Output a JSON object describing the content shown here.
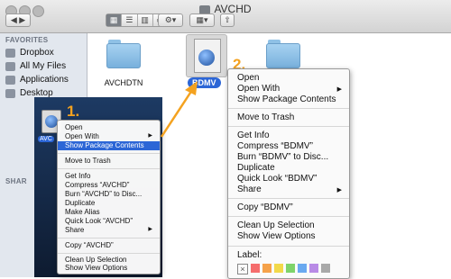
{
  "window": {
    "title": "AVCHD",
    "toolbar": {
      "gear_label": "⚙▾",
      "arrange_label": "▦▾",
      "share_label": "⇧"
    }
  },
  "sidebar": {
    "section": "FAVORITES",
    "items": [
      "Dropbox",
      "All My Files",
      "Applications",
      "Desktop"
    ],
    "shared_header": "SHAR"
  },
  "files": [
    {
      "name": "AVCHDTN"
    },
    {
      "name": "BDMV"
    }
  ],
  "desktop_file_label": "AVC",
  "steps": {
    "one": "1.",
    "two": "2."
  },
  "menu_small": {
    "items": [
      "Open",
      "Open With",
      "Show Package Contents",
      "Move to Trash",
      "Get Info",
      "Compress “AVCHD”",
      "Burn “AVCHD” to Disc...",
      "Duplicate",
      "Make Alias",
      "Quick Look “AVCHD”",
      "Share",
      "Copy “AVCHD”",
      "Clean Up Selection",
      "Show View Options"
    ]
  },
  "menu_large": {
    "items": [
      "Open",
      "Open With",
      "Show Package Contents",
      "Move to Trash",
      "Get Info",
      "Compress “BDMV”",
      "Burn “BDMV” to Disc...",
      "Duplicate",
      "Quick Look “BDMV”",
      "Share",
      "Copy “BDMV”",
      "Clean Up Selection",
      "Show View Options",
      "Label:"
    ],
    "label_swatch_close": "×"
  },
  "colors": {
    "accent_orange": "#f4a21f",
    "highlight_blue": "#2c66d6",
    "label_colors": [
      "#f56d6d",
      "#f5a24a",
      "#f2d94a",
      "#7ed36a",
      "#6aa9f0",
      "#b98be6",
      "#a9a9a9"
    ]
  },
  "icons": {
    "arrow_right": "▶"
  }
}
